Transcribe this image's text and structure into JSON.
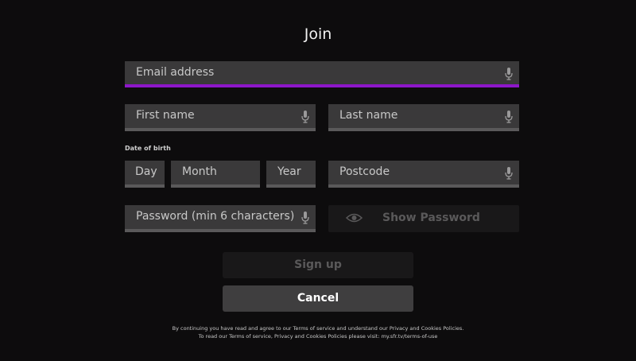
{
  "title": "Join",
  "form": {
    "email": {
      "placeholder": "Email address"
    },
    "first_name": {
      "placeholder": "First name"
    },
    "last_name": {
      "placeholder": "Last name"
    },
    "dob_label": "Date of birth",
    "day": {
      "placeholder": "Day"
    },
    "month": {
      "placeholder": "Month"
    },
    "year": {
      "placeholder": "Year"
    },
    "postcode": {
      "placeholder": "Postcode"
    },
    "password": {
      "placeholder": "Password (min 6 characters)"
    },
    "show_password_label": "Show Password"
  },
  "buttons": {
    "signup": "Sign up",
    "cancel": "Cancel"
  },
  "legal": {
    "line1": "By continuing you have read and agree to our Terms of service and understand our Privacy and Cookies Policies.",
    "line2": "To read our Terms of service, Privacy and Cookies Policies please visit: my.sfr.tv/terms-of-use"
  },
  "colors": {
    "background": "#0d0c0d",
    "field": "#3a393a",
    "focus_accent": "#8d17c9",
    "disabled_text": "#5a595a"
  },
  "icons": {
    "mic": "microphone-icon",
    "eye": "eye-icon"
  }
}
